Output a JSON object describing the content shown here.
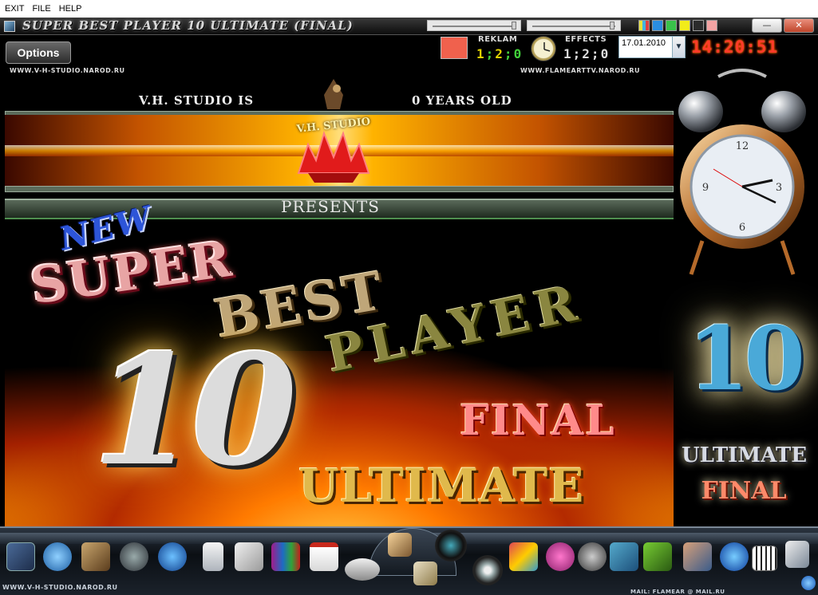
{
  "menu": {
    "exit": "EXIT",
    "file": "FILE",
    "help": "HELP"
  },
  "window": {
    "title": "SUPER BEST PLAYER 10 ULTIMATE (FINAL)",
    "minimize_label": "—",
    "close_label": "✕"
  },
  "color_swatches": [
    "#e8e23a-#43b3e0-#e04040",
    "#2a8de0",
    "#39c24a",
    "#f2ec1a",
    "#2b2b2b",
    "#f3a3a3"
  ],
  "options_label": "Options",
  "reklam": {
    "label": "REKLAM",
    "counter": [
      "1",
      ";",
      "2",
      ";",
      "0"
    ]
  },
  "effects": {
    "label": "EFFECTS",
    "counter": [
      "1",
      ";",
      "2",
      ";",
      "0"
    ]
  },
  "date": {
    "value": "17.01.2010"
  },
  "clock": {
    "time": "14:20:51"
  },
  "links": {
    "left": "WWW.V-H-STUDIO.NAROD.RU",
    "right": "WWW.FLAMEARTTV.NAROD.RU"
  },
  "banner": {
    "studio_line": "V.H. STUDIO IS",
    "years_line": "0   YEARS OLD",
    "logo_text": "V.H. STUDIO",
    "presents": "PRESENTS",
    "new": "NEW",
    "super": "SUPER",
    "best": "BEST",
    "player": "PLAYER",
    "ten": "10",
    "final": "FINAL",
    "ultimate": "ULTIMATE"
  },
  "side": {
    "ten": "10",
    "ultimate": "ULTIMATE",
    "final": "FINAL"
  },
  "status": {
    "left": "WWW.V-H-STUDIO.NAROD.RU",
    "right": "MAIL: FLAMEAR @ MAIL.RU"
  },
  "dock_icons": [
    "media-player-icon",
    "itunes-icon",
    "photo-viewer-icon",
    "flash-icon",
    "internet-explorer-icon",
    "ipod-icon",
    "mail-icon",
    "winrar-icon",
    "pdf-icon",
    "gamepad-icon",
    "photos-icon",
    "camera-icon",
    "mail-stack-icon",
    "dvd-icon",
    "paint-icon",
    "chat-icon",
    "webcam-icon",
    "settings-icon",
    "game-icon",
    "users-icon",
    "globe-icon",
    "piano-icon",
    "documents-icon",
    "refresh-icon"
  ]
}
